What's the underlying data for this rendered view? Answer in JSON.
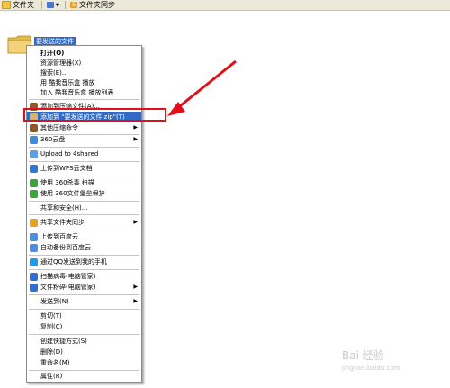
{
  "toolbar": {
    "folders_label": "文件夹",
    "sync_label": "文件夹同步",
    "view_icon": "view-grid-icon",
    "folder_icon": "folder-icon",
    "sync_icon": "sync-s-icon"
  },
  "desktop": {
    "folder_name": "要发送的文件"
  },
  "menu": {
    "items": [
      {
        "label": "打开(O)",
        "bold": true
      },
      {
        "label": "资源管理器(X)"
      },
      {
        "label": "搜索(E)..."
      },
      {
        "label": "用 酷我音乐盒 播放"
      },
      {
        "label": "加入 酷我音乐盒 播放列表"
      },
      {
        "label": "添加到压缩文件(A)..."
      },
      {
        "label": "添加到 \"要发送的文件.zip\"(T)"
      },
      {
        "label": "其他压缩命令"
      },
      {
        "label": "360云盘"
      },
      {
        "label": "Upload to 4shared"
      },
      {
        "label": "上传到WPS云文档"
      },
      {
        "label": "使用 360杀毒 扫描"
      },
      {
        "label": "使用 360文件堡垒保护"
      },
      {
        "label": "共享和安全(H)..."
      },
      {
        "label": "共享文件夹同步"
      },
      {
        "label": "上传到百度云"
      },
      {
        "label": "自动备份到百度云"
      },
      {
        "label": "通过QQ发送到我的手机"
      },
      {
        "label": "扫描病毒(电脑管家)"
      },
      {
        "label": "文件粉碎(电脑管家)"
      },
      {
        "label": "发送到(N)"
      },
      {
        "label": "剪切(T)"
      },
      {
        "label": "复制(C)"
      },
      {
        "label": "创建快捷方式(S)"
      },
      {
        "label": "删除(D)"
      },
      {
        "label": "重命名(M)"
      },
      {
        "label": "属性(R)"
      }
    ]
  },
  "watermark": {
    "line1": "Bai 经验",
    "line2": "jingyan.baidu.com"
  },
  "colors": {
    "highlight": "#316ac5",
    "annotation_red": "#e0101a"
  }
}
